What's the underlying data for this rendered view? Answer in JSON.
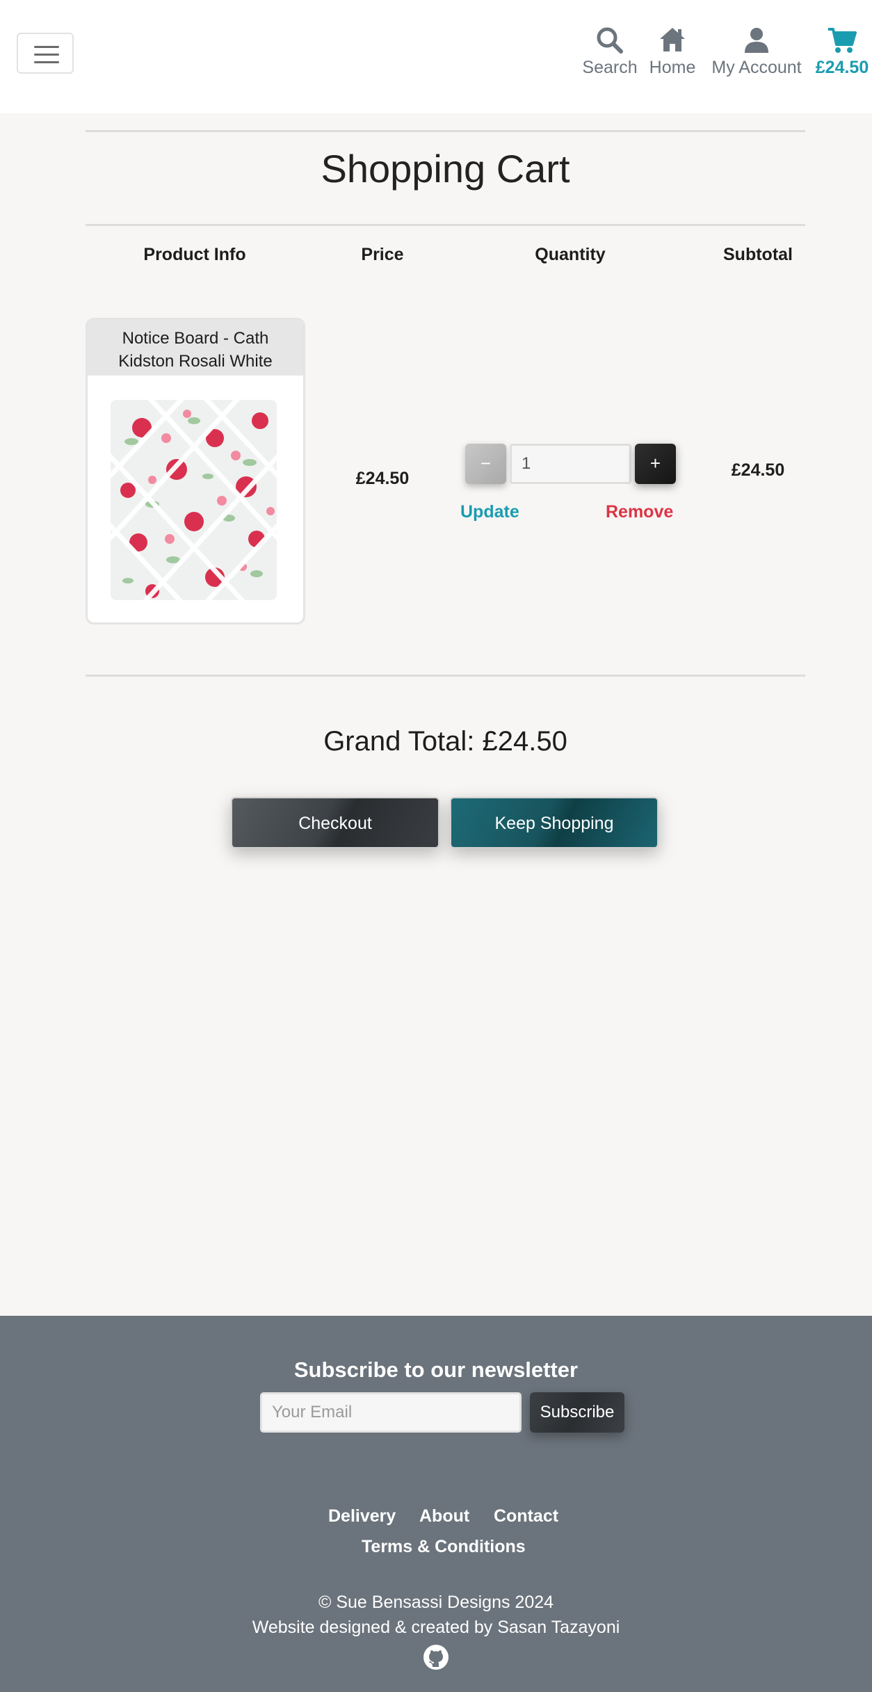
{
  "header": {
    "nav": {
      "search": "Search",
      "home": "Home",
      "account": "My Account",
      "cart_total": "£24.50"
    },
    "icons": [
      "menu-icon",
      "search-icon",
      "home-icon",
      "user-icon",
      "cart-icon"
    ],
    "accent_color": "#1a9cb0"
  },
  "page": {
    "title": "Shopping Cart"
  },
  "cart": {
    "columns": [
      "Product Info",
      "Price",
      "Quantity",
      "Subtotal"
    ],
    "items": [
      {
        "name_line1": "Notice Board - Cath",
        "name_line2": "Kidston Rosali White",
        "price": "£24.50",
        "quantity": "1",
        "subtotal": "£24.50",
        "minus_label": "−",
        "plus_label": "+",
        "update_label": "Update",
        "remove_label": "Remove"
      }
    ],
    "grand_total": "Grand Total: £24.50",
    "checkout_label": "Checkout",
    "keep_shopping_label": "Keep Shopping"
  },
  "footer": {
    "newsletter_title": "Subscribe to our newsletter",
    "email_placeholder": "Your Email",
    "subscribe_label": "Subscribe",
    "links": [
      "Delivery",
      "About",
      "Contact",
      "Terms & Conditions"
    ],
    "copyright": "© Sue Bensassi Designs 2024",
    "credit": "Website designed & created by Sasan Tazayoni",
    "background_color": "#6b737c"
  }
}
